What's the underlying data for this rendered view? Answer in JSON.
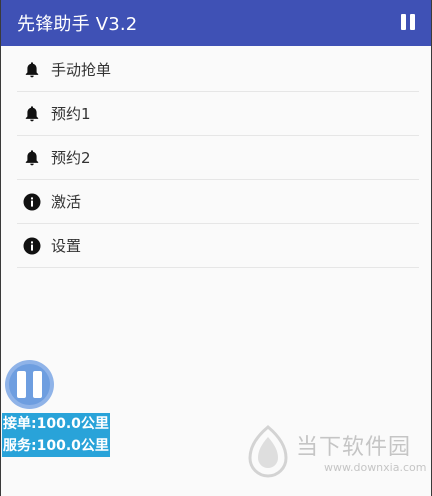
{
  "toolbar": {
    "title": "先锋助手 V3.2",
    "pause_icon": "pause-icon"
  },
  "menu": {
    "items": [
      {
        "label": "手动抢单",
        "icon": "bell-icon"
      },
      {
        "label": "预约1",
        "icon": "bell-icon"
      },
      {
        "label": "预约2",
        "icon": "bell-icon"
      },
      {
        "label": "激活",
        "icon": "info-icon"
      },
      {
        "label": "设置",
        "icon": "info-icon"
      }
    ]
  },
  "floating": {
    "icon": "pause-icon",
    "order_distance": "接单:100.0公里",
    "service_distance": "服务:100.0公里"
  },
  "watermark": {
    "text": "当下软件园",
    "url": "www.downxia.com"
  },
  "colors": {
    "toolbar": "#3f51b5",
    "stat_bg": "#29a3d9",
    "float_btn": "#6e9ee0"
  }
}
